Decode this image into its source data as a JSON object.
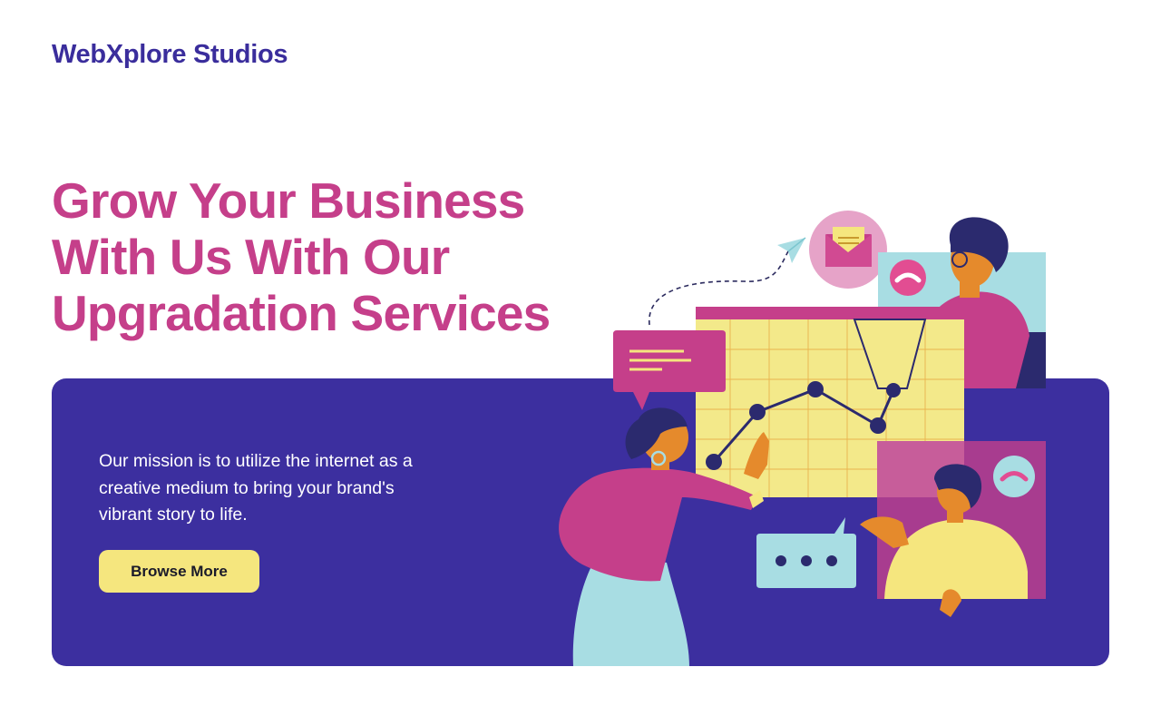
{
  "header": {
    "brand": "WebXplore Studios"
  },
  "hero": {
    "headline_lines": [
      "Grow Your Business",
      "With Us With Our",
      "Upgradation Services"
    ],
    "mission_lines": [
      "Our mission is to utilize the internet as a",
      "creative medium to bring your brand's",
      "vibrant story to life."
    ],
    "cta_label": "Browse More"
  },
  "colors": {
    "brand": "#3a2d9c",
    "headline": "#c53f8a",
    "panel": "#3c2f9f",
    "cta": "#f5e67e"
  }
}
